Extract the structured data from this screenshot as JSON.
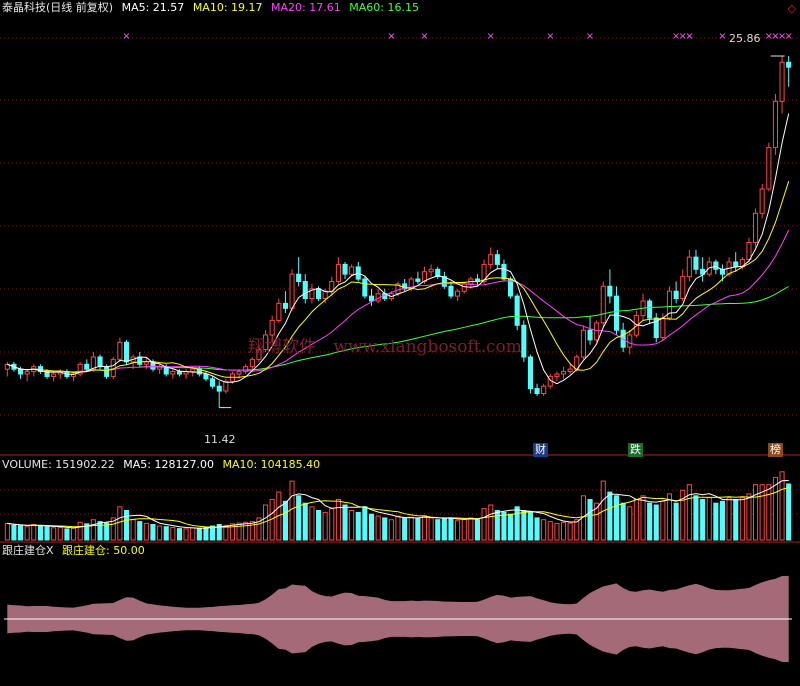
{
  "header": {
    "title": "泰晶科技(日线 前复权)",
    "ma5": "MA5: 21.57",
    "ma10": "MA10: 19.17",
    "ma20": "MA20: 17.61",
    "ma60": "MA60: 16.15"
  },
  "volume_header": {
    "label": "VOLUME: 151902.22",
    "ma5": "MA5: 128127.00",
    "ma10": "MA10: 104185.40"
  },
  "indicator_header": {
    "name": "跟庄建仓X",
    "value": "跟庄建仓: 50.00"
  },
  "annotations": {
    "high": "25.86",
    "low": "11.42",
    "badge_cai": "财",
    "badge_die": "跌",
    "badge_bang": "榜"
  },
  "watermark": {
    "cn": "翔博软件",
    "url": "www.xiangbosoft.com"
  },
  "colors": {
    "up": "#ff4545",
    "down": "#54fcfc",
    "ma5": "#ffffff",
    "ma10": "#ffff00",
    "ma20": "#ff40ff",
    "ma60": "#40ff40",
    "grid": "#8b1a1a",
    "marker": "#ff55ff",
    "indicator_fill": "#a56a78"
  },
  "chart_data": {
    "type": "candlestick",
    "price_range": [
      10.5,
      26.6
    ],
    "volume_range": [
      0,
      190000
    ],
    "marker_glyph": "×",
    "candles": [
      [
        13.0,
        13.3,
        12.7,
        13.2,
        45000
      ],
      [
        13.2,
        13.3,
        12.9,
        13.0,
        40000
      ],
      [
        13.0,
        13.1,
        12.6,
        12.8,
        38000
      ],
      [
        12.8,
        13.0,
        12.5,
        12.9,
        36000
      ],
      [
        12.9,
        13.2,
        12.7,
        13.1,
        42000
      ],
      [
        13.1,
        13.2,
        12.8,
        12.9,
        39000
      ],
      [
        12.9,
        13.0,
        12.6,
        12.7,
        35000
      ],
      [
        12.7,
        12.9,
        12.5,
        12.8,
        33000
      ],
      [
        12.8,
        13.0,
        12.6,
        12.9,
        34000
      ],
      [
        12.9,
        13.0,
        12.6,
        12.7,
        30000
      ],
      [
        12.7,
        12.9,
        12.5,
        12.8,
        32000
      ],
      [
        12.8,
        13.3,
        12.7,
        13.2,
        48000
      ],
      [
        13.2,
        13.4,
        12.9,
        13.0,
        44000
      ],
      [
        13.0,
        13.7,
        12.9,
        13.5,
        55000
      ],
      [
        13.5,
        13.6,
        13.0,
        13.1,
        50000
      ],
      [
        13.1,
        13.2,
        12.6,
        12.7,
        46000
      ],
      [
        12.7,
        13.5,
        12.6,
        13.4,
        60000
      ],
      [
        13.4,
        14.3,
        13.3,
        14.1,
        90000
      ],
      [
        14.1,
        14.2,
        13.2,
        13.3,
        80000
      ],
      [
        13.3,
        13.6,
        13.0,
        13.5,
        55000
      ],
      [
        13.5,
        13.7,
        13.1,
        13.2,
        50000
      ],
      [
        13.2,
        13.5,
        13.0,
        13.3,
        45000
      ],
      [
        13.3,
        13.4,
        12.9,
        13.0,
        42000
      ],
      [
        13.0,
        13.2,
        12.8,
        13.1,
        38000
      ],
      [
        13.1,
        13.2,
        12.7,
        12.8,
        36000
      ],
      [
        12.8,
        13.0,
        12.6,
        12.9,
        34000
      ],
      [
        12.9,
        13.0,
        12.7,
        12.8,
        31000
      ],
      [
        12.8,
        13.0,
        12.6,
        12.9,
        30000
      ],
      [
        12.9,
        13.1,
        12.7,
        13.0,
        33000
      ],
      [
        13.0,
        13.1,
        12.7,
        12.8,
        32000
      ],
      [
        12.8,
        12.9,
        12.5,
        12.6,
        35000
      ],
      [
        12.6,
        12.7,
        12.2,
        12.3,
        38000
      ],
      [
        12.3,
        12.5,
        11.42,
        12.1,
        42000
      ],
      [
        12.1,
        12.6,
        12.0,
        12.5,
        40000
      ],
      [
        12.5,
        12.9,
        12.4,
        12.8,
        44000
      ],
      [
        12.8,
        13.0,
        12.6,
        12.9,
        46000
      ],
      [
        12.9,
        13.2,
        12.8,
        13.1,
        48000
      ],
      [
        13.1,
        13.5,
        13.0,
        13.4,
        50000
      ],
      [
        13.4,
        14.0,
        13.3,
        13.8,
        60000
      ],
      [
        13.8,
        14.6,
        13.7,
        14.4,
        95000
      ],
      [
        14.4,
        15.2,
        14.1,
        15.0,
        110000
      ],
      [
        15.0,
        15.9,
        14.9,
        15.7,
        130000
      ],
      [
        15.7,
        16.2,
        15.3,
        15.5,
        105000
      ],
      [
        15.5,
        17.1,
        15.4,
        16.9,
        160000
      ],
      [
        16.9,
        17.6,
        16.4,
        16.6,
        120000
      ],
      [
        16.6,
        16.9,
        15.7,
        15.9,
        100000
      ],
      [
        15.9,
        16.5,
        15.7,
        16.3,
        90000
      ],
      [
        16.3,
        16.4,
        15.8,
        15.9,
        80000
      ],
      [
        15.9,
        16.3,
        15.7,
        16.2,
        75000
      ],
      [
        16.2,
        16.8,
        16.0,
        16.6,
        85000
      ],
      [
        16.6,
        17.6,
        16.5,
        17.3,
        110000
      ],
      [
        17.3,
        17.4,
        16.7,
        16.9,
        95000
      ],
      [
        16.9,
        17.3,
        16.8,
        17.2,
        80000
      ],
      [
        17.2,
        17.4,
        16.6,
        16.7,
        75000
      ],
      [
        16.7,
        16.8,
        15.9,
        16.0,
        90000
      ],
      [
        16.0,
        16.3,
        15.6,
        15.8,
        70000
      ],
      [
        15.8,
        16.3,
        15.7,
        16.1,
        65000
      ],
      [
        16.1,
        16.3,
        15.8,
        15.9,
        60000
      ],
      [
        15.9,
        16.2,
        15.8,
        16.1,
        55000
      ],
      [
        16.1,
        16.6,
        16.0,
        16.5,
        65000
      ],
      [
        16.5,
        16.7,
        16.2,
        16.3,
        60000
      ],
      [
        16.3,
        16.8,
        16.2,
        16.7,
        62000
      ],
      [
        16.7,
        17.0,
        16.5,
        16.6,
        58000
      ],
      [
        16.6,
        17.2,
        16.5,
        17.0,
        66000
      ],
      [
        17.0,
        17.3,
        16.8,
        17.1,
        60000
      ],
      [
        17.1,
        17.2,
        16.7,
        16.8,
        55000
      ],
      [
        16.8,
        17.0,
        16.3,
        16.4,
        58000
      ],
      [
        16.4,
        16.6,
        15.9,
        16.0,
        60000
      ],
      [
        16.0,
        16.3,
        15.8,
        16.2,
        52000
      ],
      [
        16.2,
        16.6,
        16.1,
        16.5,
        56000
      ],
      [
        16.5,
        16.8,
        16.3,
        16.7,
        60000
      ],
      [
        16.7,
        16.9,
        16.4,
        16.6,
        55000
      ],
      [
        16.6,
        17.5,
        16.5,
        17.3,
        85000
      ],
      [
        17.3,
        18.0,
        17.1,
        17.7,
        95000
      ],
      [
        17.7,
        17.9,
        17.1,
        17.3,
        80000
      ],
      [
        17.3,
        17.5,
        16.6,
        16.7,
        75000
      ],
      [
        16.7,
        16.8,
        15.9,
        16.0,
        70000
      ],
      [
        16.0,
        16.1,
        14.6,
        14.8,
        90000
      ],
      [
        14.8,
        15.0,
        13.3,
        13.5,
        80000
      ],
      [
        13.5,
        13.6,
        12.0,
        12.2,
        75000
      ],
      [
        12.2,
        12.4,
        11.9,
        12.0,
        60000
      ],
      [
        12.0,
        12.4,
        11.9,
        12.3,
        55000
      ],
      [
        12.3,
        12.8,
        12.2,
        12.7,
        50000
      ],
      [
        12.7,
        12.9,
        12.5,
        12.8,
        45000
      ],
      [
        12.8,
        13.1,
        12.6,
        12.9,
        48000
      ],
      [
        12.9,
        13.2,
        12.8,
        13.0,
        46000
      ],
      [
        13.0,
        13.6,
        12.9,
        13.5,
        55000
      ],
      [
        13.5,
        14.8,
        13.4,
        14.6,
        120000
      ],
      [
        14.6,
        15.2,
        14.0,
        14.2,
        110000
      ],
      [
        14.2,
        15.0,
        14.1,
        14.9,
        100000
      ],
      [
        14.9,
        16.6,
        14.7,
        16.4,
        160000
      ],
      [
        16.4,
        17.1,
        15.7,
        16.0,
        130000
      ],
      [
        16.0,
        16.4,
        14.4,
        14.6,
        120000
      ],
      [
        14.6,
        14.9,
        13.7,
        13.9,
        100000
      ],
      [
        13.9,
        14.6,
        13.6,
        14.4,
        90000
      ],
      [
        14.4,
        15.4,
        14.3,
        15.2,
        110000
      ],
      [
        15.2,
        16.1,
        15.0,
        15.8,
        120000
      ],
      [
        15.8,
        15.9,
        14.9,
        15.1,
        100000
      ],
      [
        15.1,
        15.3,
        14.1,
        14.3,
        95000
      ],
      [
        14.3,
        15.3,
        14.2,
        15.1,
        105000
      ],
      [
        15.1,
        16.4,
        15.0,
        16.2,
        125000
      ],
      [
        16.2,
        16.6,
        15.7,
        15.9,
        100000
      ],
      [
        15.9,
        17.1,
        15.8,
        16.8,
        135000
      ],
      [
        16.8,
        17.9,
        16.6,
        17.6,
        150000
      ],
      [
        17.6,
        17.9,
        16.9,
        17.1,
        120000
      ],
      [
        17.1,
        17.6,
        16.6,
        16.9,
        110000
      ],
      [
        16.9,
        17.6,
        16.8,
        17.4,
        115000
      ],
      [
        17.4,
        17.5,
        16.9,
        17.1,
        100000
      ],
      [
        17.1,
        17.3,
        16.6,
        16.9,
        105000
      ],
      [
        16.9,
        17.6,
        16.8,
        17.4,
        115000
      ],
      [
        17.4,
        17.8,
        17.0,
        17.2,
        110000
      ],
      [
        17.2,
        17.6,
        17.1,
        17.5,
        115000
      ],
      [
        17.5,
        18.4,
        17.4,
        18.2,
        125000
      ],
      [
        18.2,
        19.6,
        18.0,
        19.4,
        150000
      ],
      [
        19.4,
        20.6,
        19.2,
        20.4,
        150000
      ],
      [
        20.4,
        22.3,
        20.3,
        22.1,
        150000
      ],
      [
        22.1,
        24.3,
        21.8,
        24.0,
        170000
      ],
      [
        24.0,
        25.86,
        23.5,
        25.6,
        185000
      ],
      [
        25.6,
        25.86,
        24.6,
        25.4,
        151902
      ]
    ]
  }
}
